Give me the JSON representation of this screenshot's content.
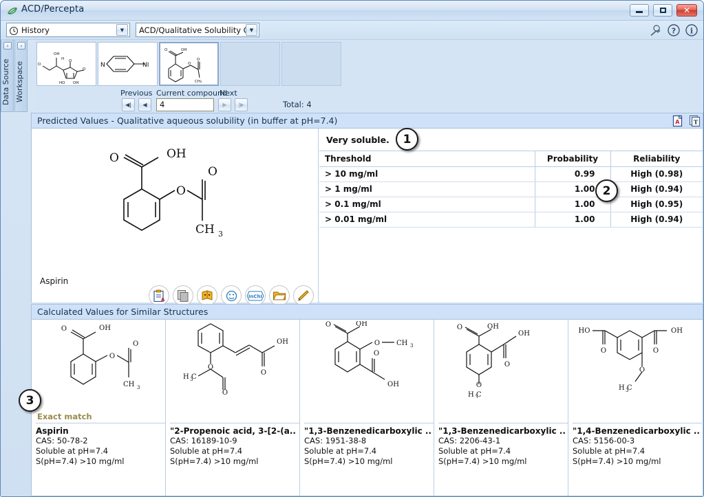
{
  "window": {
    "title": "ACD/Percepta",
    "app_icon": "leaf-icon",
    "controls": {
      "minimize": "minimize-icon",
      "maximize": "maximize-icon",
      "close": "close-icon"
    }
  },
  "toolbar": {
    "history_label": "History",
    "history_icon": "clock-icon",
    "module_label": "ACD/Qualitative Solubility GA...",
    "wrench_icon": "wrench-icon",
    "help_icon": "question-icon",
    "info_icon": "info-icon"
  },
  "side_tabs": [
    {
      "label": "Data Source",
      "expander": "›"
    },
    {
      "label": "Workspace",
      "expander": "›"
    }
  ],
  "thumbnails": [
    {
      "name": "ascorbic-acid-thumbnail",
      "selected": false
    },
    {
      "name": "aminopyridine-thumbnail",
      "selected": false
    },
    {
      "name": "aspirin-thumbnail",
      "selected": true
    },
    {
      "name": "empty-slot-1",
      "selected": false
    },
    {
      "name": "empty-slot-2",
      "selected": false
    }
  ],
  "navigation": {
    "previous_label": "Previous",
    "current_label": "Current compound",
    "next_label": "Next",
    "current_value": "4",
    "total_label": "Total: 4",
    "first_glyph": "◀|",
    "prev_glyph": "◀",
    "next_glyph": "▶",
    "last_glyph": "|▶"
  },
  "predicted_panel": {
    "title": "Predicted Values - Qualitative aqueous solubility (in buffer at pH=7.4)",
    "pdf_icon": "pdf-export-icon",
    "doc_icon": "text-report-icon",
    "verdict": "Very soluble.",
    "compound_name": "Aspirin",
    "structure_icon": "aspirin-structure",
    "table": {
      "headers": [
        "Threshold",
        "Probability",
        "Reliability"
      ],
      "rows": [
        {
          "threshold": "> 10 mg/ml",
          "probability": "0.99",
          "reliability": "High (0.98)"
        },
        {
          "threshold": "> 1 mg/ml",
          "probability": "1.00",
          "reliability": "High (0.94)"
        },
        {
          "threshold": "> 0.1 mg/ml",
          "probability": "1.00",
          "reliability": "High (0.95)"
        },
        {
          "threshold": "> 0.01 mg/ml",
          "probability": "1.00",
          "reliability": "High (0.94)"
        }
      ]
    },
    "structure_tools": [
      "paste-structure-icon",
      "copy-structure-icon",
      "dictionary-icon",
      "smiles-icon",
      "inchi-icon",
      "open-file-icon",
      "edit-structure-icon"
    ],
    "inchi_label": "InChI"
  },
  "similar_panel": {
    "title": "Calculated Values for Similar Structures",
    "cards": [
      {
        "match": "Exact match",
        "name": "Aspirin",
        "cas": "CAS: 50-78-2",
        "soluble": "Soluble at pH=7.4",
        "value": "S(pH=7.4) >10 mg/ml",
        "structure": "aspirin-structure"
      },
      {
        "match": "",
        "name": "\"2-Propenoic acid, 3-[2-(a..",
        "cas": "CAS: 16189-10-9",
        "soluble": "Soluble at pH=7.4",
        "value": "S(pH=7.4) >10 mg/ml",
        "structure": "o-acetoxycinnamic-acid-structure"
      },
      {
        "match": "",
        "name": "\"1,3-Benzenedicarboxylic ..",
        "cas": "CAS: 1951-38-8",
        "soluble": "Soluble at pH=7.4",
        "value": "S(pH=7.4) >10 mg/ml",
        "structure": "methoxy-isophthalic-acid-structure"
      },
      {
        "match": "",
        "name": "\"1,3-Benzenedicarboxylic ..",
        "cas": "CAS: 2206-43-1",
        "soluble": "Soluble at pH=7.4",
        "value": "S(pH=7.4) >10 mg/ml",
        "structure": "methoxy-isophthalic-acid-2-structure"
      },
      {
        "match": "",
        "name": "\"1,4-Benzenedicarboxylic ..",
        "cas": "CAS: 5156-00-3",
        "soluble": "Soluble at pH=7.4",
        "value": "S(pH=7.4) >10 mg/ml",
        "structure": "methoxy-terephthalic-acid-structure"
      }
    ]
  },
  "callouts": [
    {
      "id": "1",
      "text": "1"
    },
    {
      "id": "2",
      "text": "2"
    },
    {
      "id": "3",
      "text": "3"
    }
  ],
  "colors": {
    "accent": "#cfe1f8",
    "reliability_green": "#0a8a0a",
    "match_olive": "#9a8a4c",
    "close_red": "#cf3b2e"
  }
}
